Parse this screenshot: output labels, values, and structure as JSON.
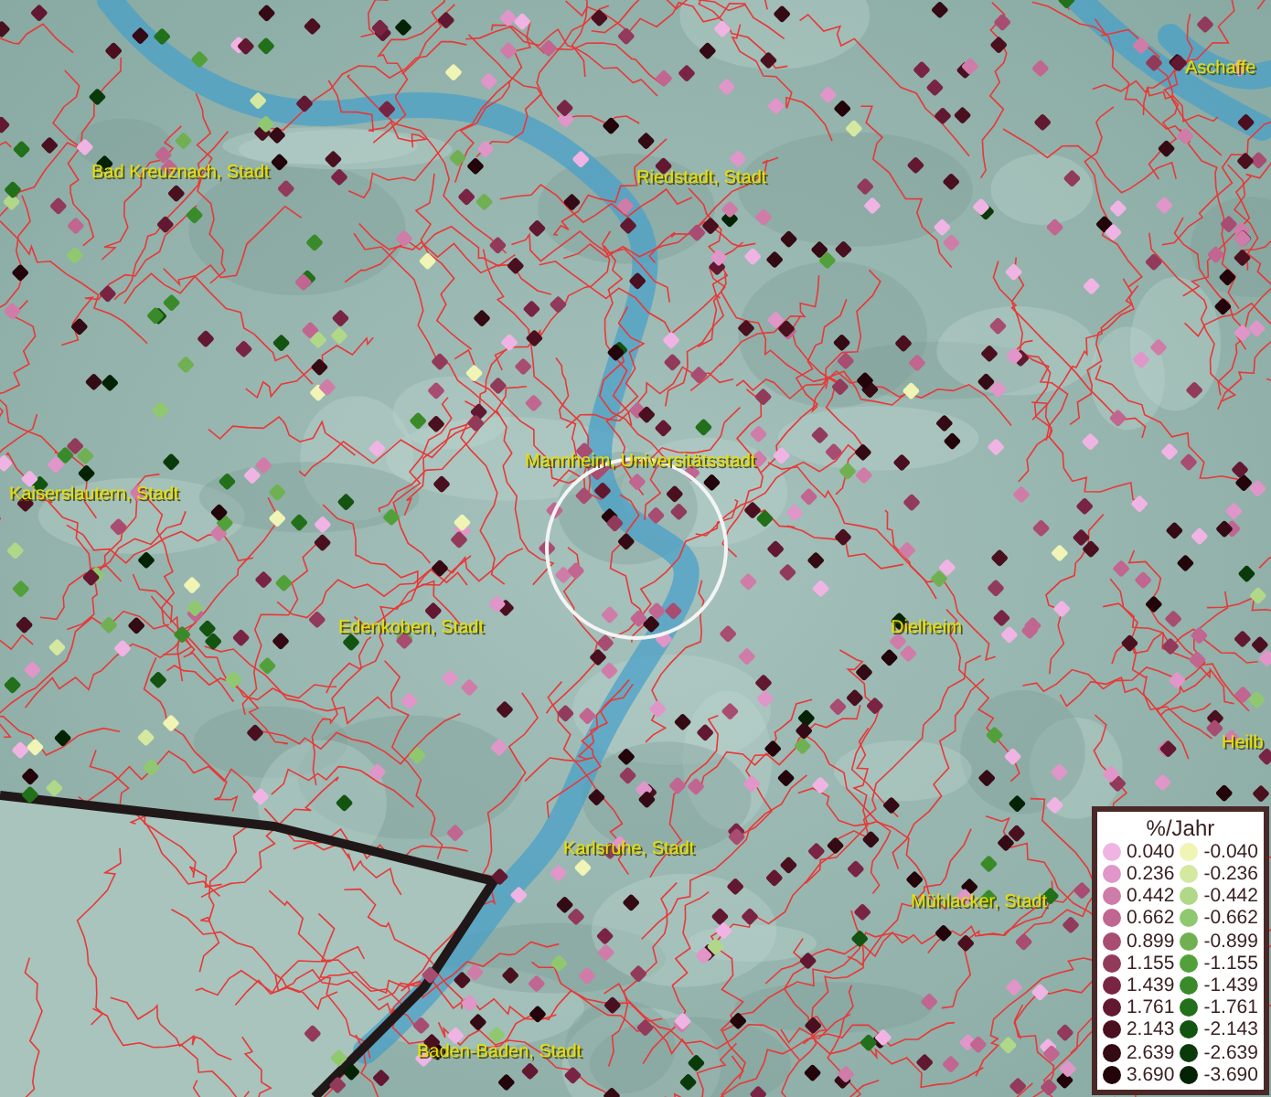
{
  "map": {
    "places": [
      {
        "name": "Aschaffe"
      },
      {
        "name": "Bad Kreuznach, Stadt"
      },
      {
        "name": "Riedstadt, Stadt"
      },
      {
        "name": "Mannheim, Universitätsstadt"
      },
      {
        "name": "Kaiserslautern, Stadt"
      },
      {
        "name": "Edenkoben, Stadt"
      },
      {
        "name": "Dielheim"
      },
      {
        "name": "Heilb"
      },
      {
        "name": "Karlsruhe, Stadt"
      },
      {
        "name": "Mühlacker, Stadt"
      },
      {
        "name": "Baden-Baden, Stadt"
      }
    ]
  },
  "legend": {
    "title": "%/Jahr",
    "positive": [
      {
        "label": "0.040",
        "color": "#f0b4e4"
      },
      {
        "label": "0.236",
        "color": "#e096c8"
      },
      {
        "label": "0.442",
        "color": "#d07ca8"
      },
      {
        "label": "0.662",
        "color": "#c06690"
      },
      {
        "label": "0.899",
        "color": "#a84c72"
      },
      {
        "label": "1.155",
        "color": "#923a5a"
      },
      {
        "label": "1.439",
        "color": "#7a2444"
      },
      {
        "label": "1.761",
        "color": "#621830"
      },
      {
        "label": "2.143",
        "color": "#4a1020"
      },
      {
        "label": "2.639",
        "color": "#340a14"
      },
      {
        "label": "3.690",
        "color": "#22040a"
      }
    ],
    "negative": [
      {
        "label": "-0.040",
        "color": "#f0f4b4"
      },
      {
        "label": "-0.236",
        "color": "#d4e8a0"
      },
      {
        "label": "-0.442",
        "color": "#b0d888"
      },
      {
        "label": "-0.662",
        "color": "#90c870"
      },
      {
        "label": "-0.899",
        "color": "#70b052"
      },
      {
        "label": "-1.155",
        "color": "#52a03a"
      },
      {
        "label": "-1.439",
        "color": "#3a8a2a"
      },
      {
        "label": "-1.761",
        "color": "#22701a"
      },
      {
        "label": "-2.143",
        "color": "#125410"
      },
      {
        "label": "-2.639",
        "color": "#0a3a0a"
      },
      {
        "label": "-3.690",
        "color": "#042204"
      }
    ]
  }
}
